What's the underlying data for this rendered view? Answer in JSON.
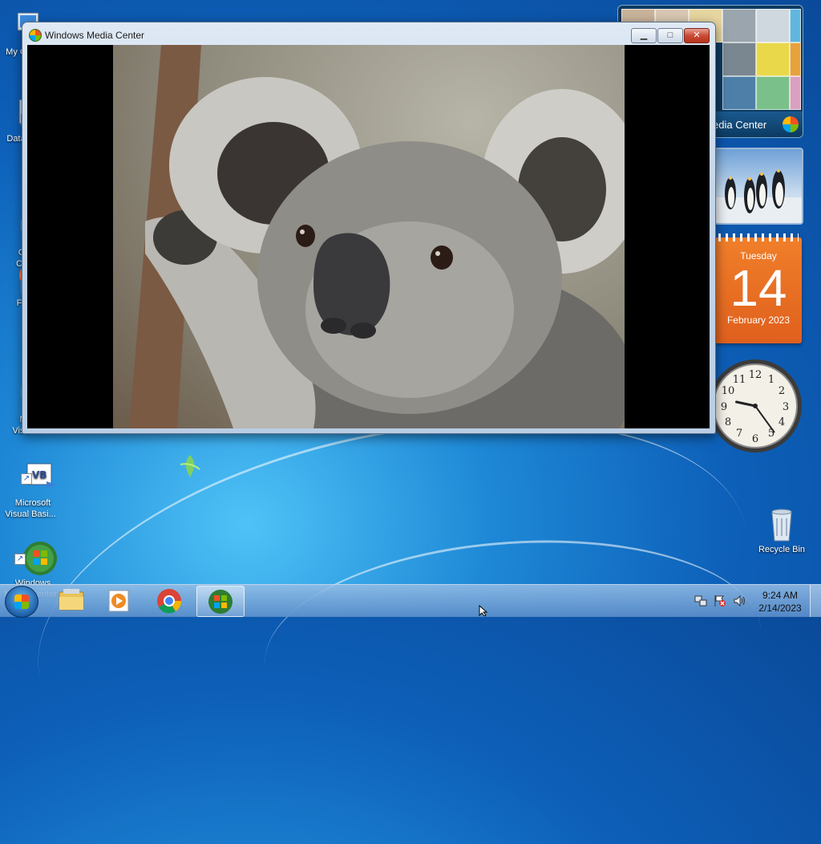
{
  "desktop": {
    "icons": [
      {
        "label": "My C"
      },
      {
        "label": "Data"
      },
      {
        "label": "G\nC"
      },
      {
        "label": "F"
      },
      {
        "label": "M\nVisu"
      },
      {
        "label": "Microsoft\nVisual Basi..."
      },
      {
        "label": "Windows\nMedia Center"
      },
      {
        "label": "Recycle Bin"
      }
    ]
  },
  "window": {
    "title": "Windows Media Center",
    "minimize_label": "▁",
    "maximize_label": "□",
    "close_label": "✕"
  },
  "gadgets": {
    "media_center_label": "edia Center",
    "calendar": {
      "weekday": "Tuesday",
      "day": "14",
      "month_year": "February 2023"
    },
    "clock": {
      "hour": 9,
      "minute": 24
    }
  },
  "taskbar": {
    "time": "9:24 AM",
    "date": "2/14/2023"
  },
  "colors": {
    "taskbar": "#7fa9d8",
    "calendar": "#e8691f",
    "desktop": "#1e78cf"
  }
}
